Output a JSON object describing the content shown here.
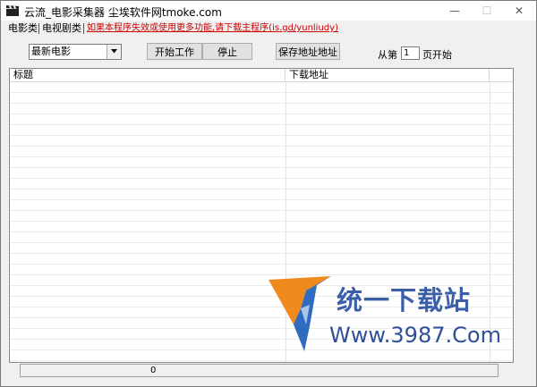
{
  "window": {
    "title": "云流_电影采集器  尘埃软件网tmoke.com",
    "minimize_glyph": "—",
    "maximize_glyph": "☐",
    "close_glyph": "✕"
  },
  "tabs": [
    {
      "label": "电影类"
    },
    {
      "label": "电视剧类"
    }
  ],
  "promo_link": "如果本程序失效或使用更多功能,请下载主程序(is.gd/yunliudy)",
  "category_select": {
    "selected": "最新电影"
  },
  "buttons": {
    "start": "开始工作",
    "stop": "停止",
    "save": "保存地址地址"
  },
  "paging": {
    "prefix": "从第",
    "page": "1",
    "suffix": "页开始"
  },
  "list": {
    "columns": [
      "标题",
      "下载地址"
    ]
  },
  "watermark": {
    "chinese": "统一下载站",
    "url": "Www.3987.Com"
  },
  "status": {
    "count": "0"
  },
  "colors": {
    "promo_link": "#cc0000",
    "watermark_blue": "#3a5ea8",
    "watermark_orange": "#f08a1d"
  }
}
